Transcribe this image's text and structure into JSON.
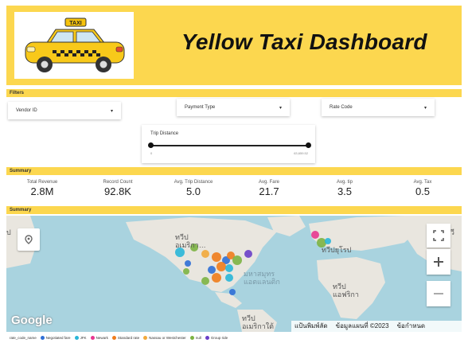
{
  "header": {
    "title": "Yellow Taxi Dashboard",
    "logo_sign": "TAXI"
  },
  "sections": {
    "filters": "Filters",
    "summary": "Summary",
    "summary_map": "Summary"
  },
  "filters": {
    "vendor": {
      "label": "Vendor ID",
      "caret": "▾"
    },
    "payment": {
      "label": "Payment Type",
      "caret": "▾"
    },
    "rate": {
      "label": "Rate Code",
      "caret": "▾"
    },
    "trip": {
      "label": "Trip Distance",
      "min": "0",
      "max": "63,659.52"
    }
  },
  "stats": [
    {
      "label": "Total Revenue",
      "value": "2.8M"
    },
    {
      "label": "Record Count",
      "value": "92.8K"
    },
    {
      "label": "Avg. Trip Distance",
      "value": "5.0"
    },
    {
      "label": "Avg. Fare",
      "value": "21.7"
    },
    {
      "label": "Avg. tip",
      "value": "3.5"
    },
    {
      "label": "Avg. Tax",
      "value": "0.5"
    }
  ],
  "map": {
    "labels": {
      "na": "ทวีป\nอเมริกา…",
      "atlantic": "มหาสมุทร\nแอตแลนติก",
      "europe": "ทวีปยุโรป",
      "africa": "ทวีป\nแอฟริกา",
      "sa": "ทวีป\nอเมริกาใต้",
      "left_edge": "ป",
      "right_edge": "ทวี"
    },
    "google": "Google",
    "shortcuts": "แป้นพิมพ์ลัด",
    "copyright": "ข้อมูลแผนที่ ©2023",
    "terms": "ข้อกำหนด"
  },
  "legend": {
    "title": "rate_code_name",
    "items": [
      {
        "name": "Negotiated fare",
        "color": "#2f6fd6"
      },
      {
        "name": "JFK",
        "color": "#29b6d8"
      },
      {
        "name": "Newark",
        "color": "#e8368f"
      },
      {
        "name": "Standard rate",
        "color": "#f07c1c"
      },
      {
        "name": "Nassau or Westchester",
        "color": "#f2a93b"
      },
      {
        "name": "null",
        "color": "#7cb342"
      },
      {
        "name": "Group ride",
        "color": "#6a3fc8"
      }
    ]
  }
}
